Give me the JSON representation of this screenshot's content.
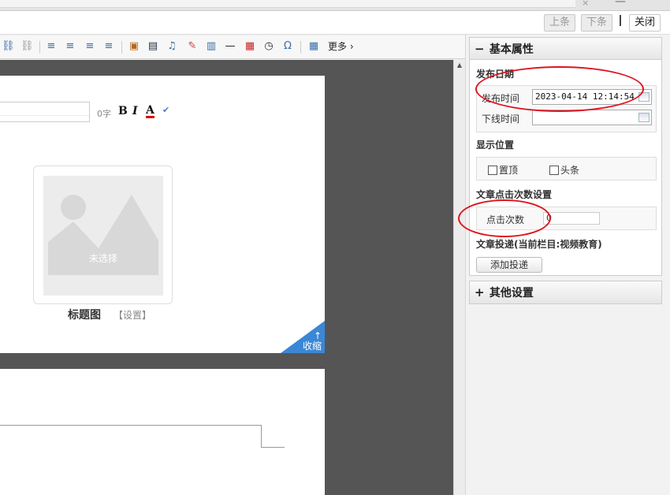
{
  "window": {
    "close_glyph": "×",
    "min_glyph": "—"
  },
  "action_bar": {
    "prev_label": "上条",
    "next_label": "下条",
    "close_label": "关闭"
  },
  "toolbar": {
    "more_label": "更多",
    "icons": [
      "link-icon",
      "unlink-icon",
      "align-left-icon",
      "align-center-icon",
      "align-right-icon",
      "align-justify-icon",
      "image-icon",
      "video-icon",
      "music-icon",
      "picture-icon",
      "template-icon",
      "horizontal-rule-icon",
      "date-icon",
      "time-icon",
      "special-char-icon",
      "table-icon"
    ]
  },
  "editor": {
    "word_count": "0字",
    "bold_label": "B",
    "italic_label": "I",
    "font_color_label": "A",
    "thumbnail": {
      "placeholder": "未选择",
      "caption": "标题图",
      "set_label": "【设置】"
    },
    "collapse": {
      "arrow": "↑",
      "label": "收缩"
    }
  },
  "panel": {
    "basic": {
      "title": "基本属性",
      "toggle": "−",
      "publish_date": {
        "section_title": "发布日期",
        "publish_time_label": "发布时间",
        "publish_time_value": "2023-04-14 12:14:54",
        "offline_time_label": "下线时间",
        "offline_time_value": ""
      },
      "display": {
        "section_title": "显示位置",
        "pin_top_label": "置顶",
        "headline_label": "头条"
      },
      "clicks": {
        "section_title": "文章点击次数设置",
        "click_count_label": "点击次数",
        "click_count_value": "0"
      },
      "delivery": {
        "section_title": "文章投递(当前栏目:视频教育)",
        "add_button_label": "添加投递"
      }
    },
    "other": {
      "title": "其他设置",
      "toggle": "+"
    }
  },
  "colors": {
    "highlight_oval": "#e0141c",
    "collapse_corner": "#3b87d6",
    "canvas_bg": "#555555"
  }
}
